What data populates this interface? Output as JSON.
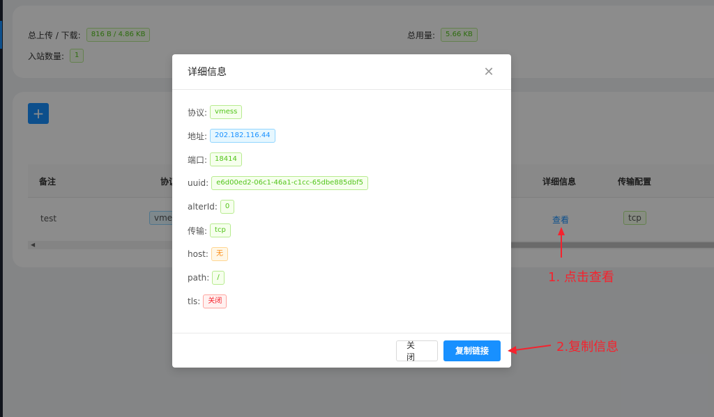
{
  "stats": {
    "traffic_label": "总上传 / 下载:",
    "traffic_value": "816 B / 4.86 KB",
    "usage_label": "总用量:",
    "usage_value": "5.66 KB",
    "inbound_label": "入站数量:",
    "inbound_value": "1"
  },
  "toolbar": {
    "add_icon": "plus-icon",
    "add_label": "+"
  },
  "table": {
    "headers": {
      "remark": "备注",
      "protocol": "协议",
      "details": "详细信息",
      "transport": "传输配置"
    },
    "row": {
      "remark": "test",
      "protocol": "vmess",
      "details_link": "查看",
      "transport": "tcp"
    }
  },
  "modal": {
    "title": "详细信息",
    "fields": [
      {
        "key": "协议:",
        "value": "vmess",
        "color": "green"
      },
      {
        "key": "地址:",
        "value": "202.182.116.44",
        "color": "blue"
      },
      {
        "key": "端口:",
        "value": "18414",
        "color": "green"
      },
      {
        "key": "uuid:",
        "value": "e6d00ed2-06c1-46a1-c1cc-65dbe885dbf5",
        "color": "green"
      },
      {
        "key": "alterId:",
        "value": "0",
        "color": "green"
      },
      {
        "key": "传输:",
        "value": "tcp",
        "color": "green"
      },
      {
        "key": "host:",
        "value": "无",
        "color": "orange"
      },
      {
        "key": "path:",
        "value": "/",
        "color": "green"
      },
      {
        "key": "tls:",
        "value": "关闭",
        "color": "red"
      }
    ],
    "close_label": "关 闭",
    "copy_label": "复制链接"
  },
  "annotations": {
    "step1": "1. 点击查看",
    "step2": "2.复制信息",
    "color": "#f5222d"
  }
}
